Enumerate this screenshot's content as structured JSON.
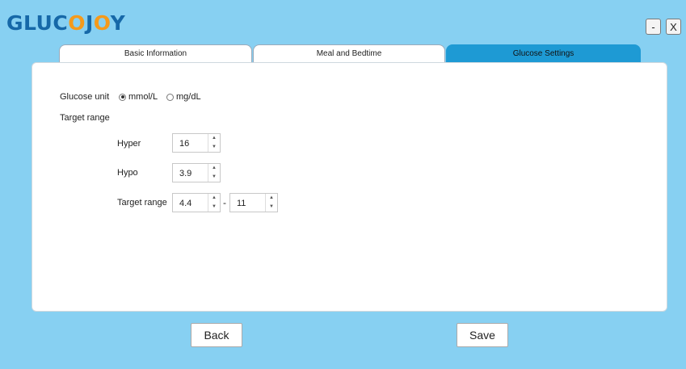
{
  "app": {
    "logo_prefix": "GLUC",
    "logo_highlight": "O",
    "logo_mid": "J",
    "logo_highlight2": "O",
    "logo_suffix": "Y",
    "minimize_label": "-",
    "close_label": "X"
  },
  "tabs": [
    {
      "label": "Basic Information",
      "active": false
    },
    {
      "label": "Meal and Bedtime",
      "active": false
    },
    {
      "label": "Glucose Settings",
      "active": true
    }
  ],
  "settings": {
    "glucose_unit_label": "Glucose unit",
    "unit_options": [
      {
        "label": "mmol/L",
        "selected": true
      },
      {
        "label": "mg/dL",
        "selected": false
      }
    ],
    "target_range_heading": "Target range",
    "hyper": {
      "label": "Hyper",
      "value": "16"
    },
    "hypo": {
      "label": "Hypo",
      "value": "3.9"
    },
    "target_range": {
      "label": "Target range",
      "low": "4.4",
      "separator": "-",
      "high": "11"
    },
    "spinner_up": "▲",
    "spinner_down": "▼"
  },
  "footer": {
    "back_label": "Back",
    "save_label": "Save"
  },
  "colors": {
    "background": "#87d0f2",
    "active_tab": "#1e9ad4",
    "logo_blue": "#1668a8",
    "logo_orange": "#f59a1b"
  }
}
